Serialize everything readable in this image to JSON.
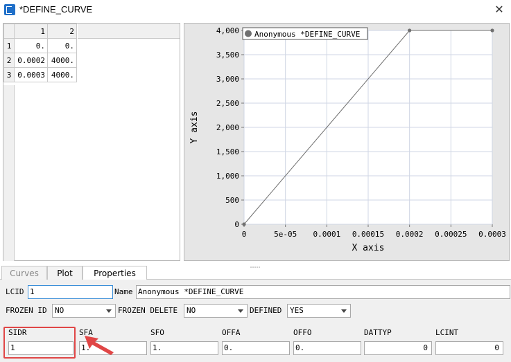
{
  "window": {
    "title": "*DEFINE_CURVE"
  },
  "table": {
    "columns": [
      "1",
      "2"
    ],
    "rows": [
      {
        "n": "1",
        "a": "0.",
        "b": "0."
      },
      {
        "n": "2",
        "a": "0.0002",
        "b": "4000."
      },
      {
        "n": "3",
        "a": "0.0003",
        "b": "4000."
      }
    ]
  },
  "chart_data": {
    "type": "line",
    "series": [
      {
        "name": "Anonymous *DEFINE_CURVE",
        "x": [
          0,
          0.0002,
          0.0003
        ],
        "y": [
          0,
          4000,
          4000
        ]
      }
    ],
    "xlabel": "X axis",
    "ylabel": "Y axis",
    "xlim": [
      0,
      0.0003
    ],
    "ylim": [
      0,
      4000
    ],
    "xticks": [
      "0",
      "5e-05",
      "0.0001",
      "0.00015",
      "0.0002",
      "0.00025",
      "0.0003"
    ],
    "yticks": [
      "0",
      "500",
      "1,000",
      "1,500",
      "2,000",
      "2,500",
      "3,000",
      "3,500",
      "4,000"
    ],
    "grid": true,
    "legend": "top-left",
    "line_color": "#707070"
  },
  "tabs": [
    "Curves",
    "Plot",
    "Properties"
  ],
  "properties": {
    "lcid_label": "LCID",
    "lcid_value": "1",
    "name_label": "Name",
    "name_value": "Anonymous *DEFINE_CURVE",
    "frozen_id_label": "FROZEN ID",
    "frozen_id_value": "NO",
    "frozen_delete_label": "FROZEN DELETE",
    "frozen_delete_value": "NO",
    "defined_label": "DEFINED",
    "defined_value": "YES",
    "fields": [
      {
        "label": "SIDR",
        "value": "1"
      },
      {
        "label": "SFA",
        "value": "1."
      },
      {
        "label": "SFO",
        "value": "1."
      },
      {
        "label": "OFFA",
        "value": "0."
      },
      {
        "label": "OFFO",
        "value": "0."
      },
      {
        "label": "DATTYP",
        "value": "0"
      },
      {
        "label": "LCINT",
        "value": "0"
      }
    ]
  },
  "annotation_color": "#e04646"
}
